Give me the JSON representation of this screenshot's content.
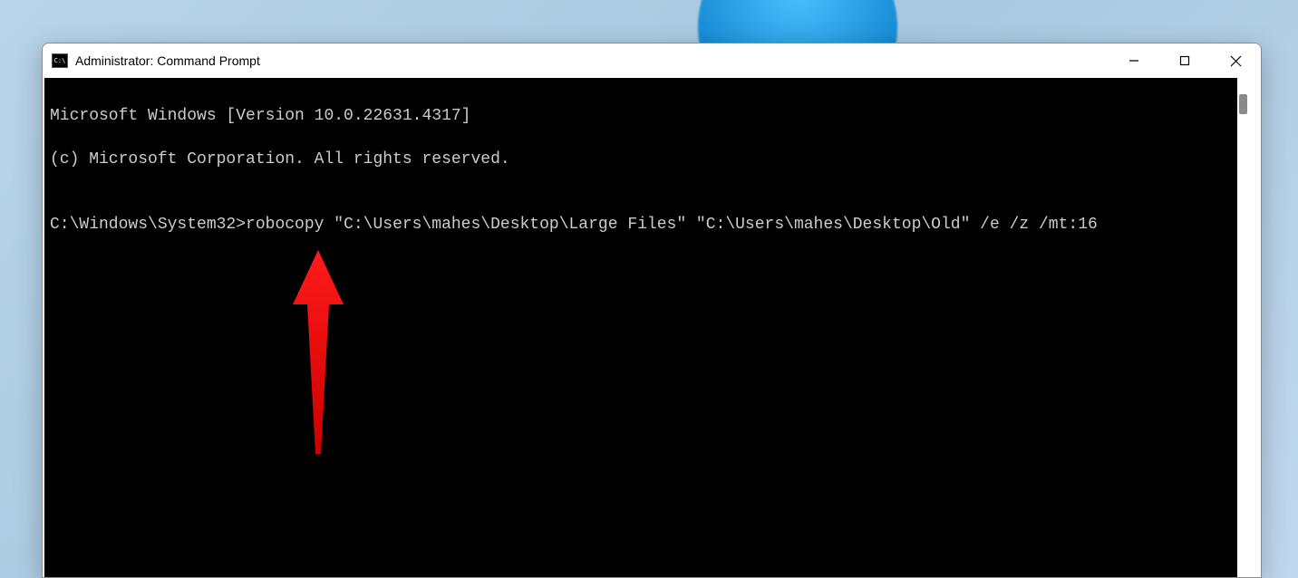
{
  "window": {
    "title": "Administrator: Command Prompt"
  },
  "terminal": {
    "line1": "Microsoft Windows [Version 10.0.22631.4317]",
    "line2": "(c) Microsoft Corporation. All rights reserved.",
    "blank": "",
    "prompt": "C:\\Windows\\System32>",
    "command": "robocopy \"C:\\Users\\mahes\\Desktop\\Large Files\" \"C:\\Users\\mahes\\Desktop\\Old\" /e /z /mt:16"
  },
  "colors": {
    "terminal_bg": "#000000",
    "terminal_fg": "#cccccc",
    "arrow": "#e60000"
  }
}
